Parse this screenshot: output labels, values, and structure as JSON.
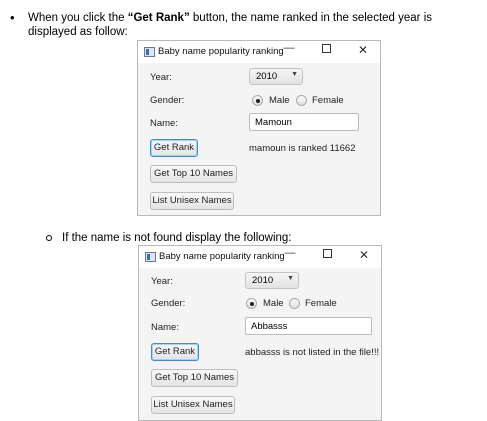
{
  "intro": {
    "bullet": "•",
    "text_before": "When you click the ",
    "bold": "“Get Rank”",
    "text_after": " button, the name ranked in the selected year is displayed as follow:"
  },
  "sub": {
    "text": "If the name is not found display the following:"
  },
  "windows": [
    {
      "title": "Baby name popularity ranking",
      "controls": {
        "minimize": "—",
        "close": "✕"
      },
      "year_label": "Year:",
      "year_value": "2010",
      "gender_label": "Gender:",
      "gender_male": "Male",
      "gender_female": "Female",
      "gender_selected": "Male",
      "name_label": "Name:",
      "name_value": "Mamoun",
      "get_rank": "Get Rank",
      "get_top10": "Get Top 10 Names",
      "list_unisex": "List Unisex Names",
      "message": "mamoun is ranked 11662"
    },
    {
      "title": "Baby name popularity ranking",
      "controls": {
        "minimize": "—",
        "close": "✕"
      },
      "year_label": "Year:",
      "year_value": "2010",
      "gender_label": "Gender:",
      "gender_male": "Male",
      "gender_female": "Female",
      "gender_selected": "Male",
      "name_label": "Name:",
      "name_value": "Abbasss",
      "get_rank": "Get Rank",
      "get_top10": "Get Top 10 Names",
      "list_unisex": "List Unisex Names",
      "message": "abbasss is not listed in the file!!!"
    }
  ]
}
